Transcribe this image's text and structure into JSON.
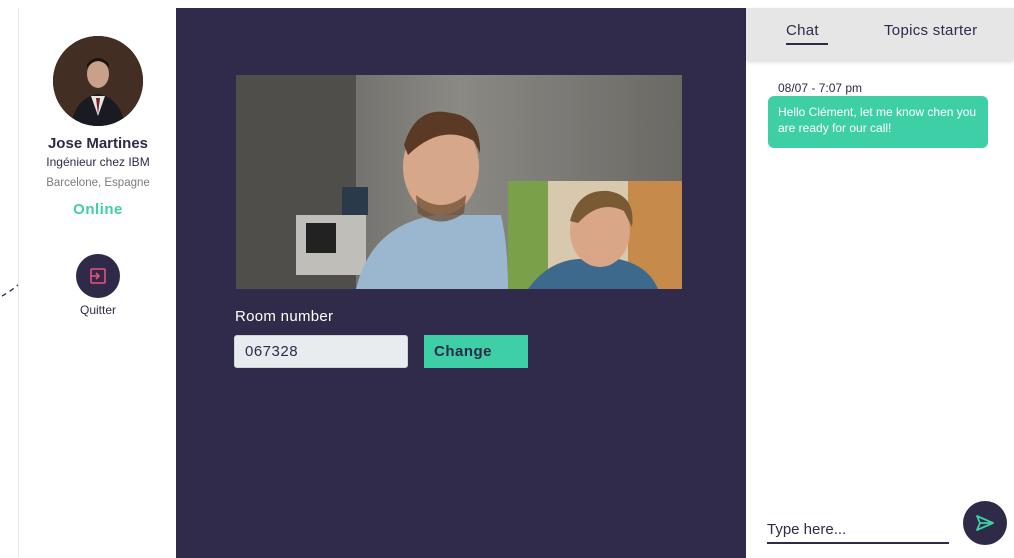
{
  "profile": {
    "name": "Jose Martines",
    "job": "Ingénieur chez IBM",
    "location": "Barcelone, Espagne",
    "status": "Online",
    "quit_label": "Quitter"
  },
  "room": {
    "label": "Room number",
    "value": "067328",
    "change_label": "Change"
  },
  "chat": {
    "tabs": [
      "Chat",
      "Topics starter"
    ],
    "active_tab": "Chat",
    "messages": [
      {
        "time": "08/07 - 7:07 pm",
        "text": "Hello Clément, let me know chen you are ready for our call!"
      }
    ],
    "input_placeholder": "Type here..."
  },
  "colors": {
    "accent": "#3fcfa6",
    "dark": "#302b4b",
    "quit_icon": "#e8517e"
  }
}
